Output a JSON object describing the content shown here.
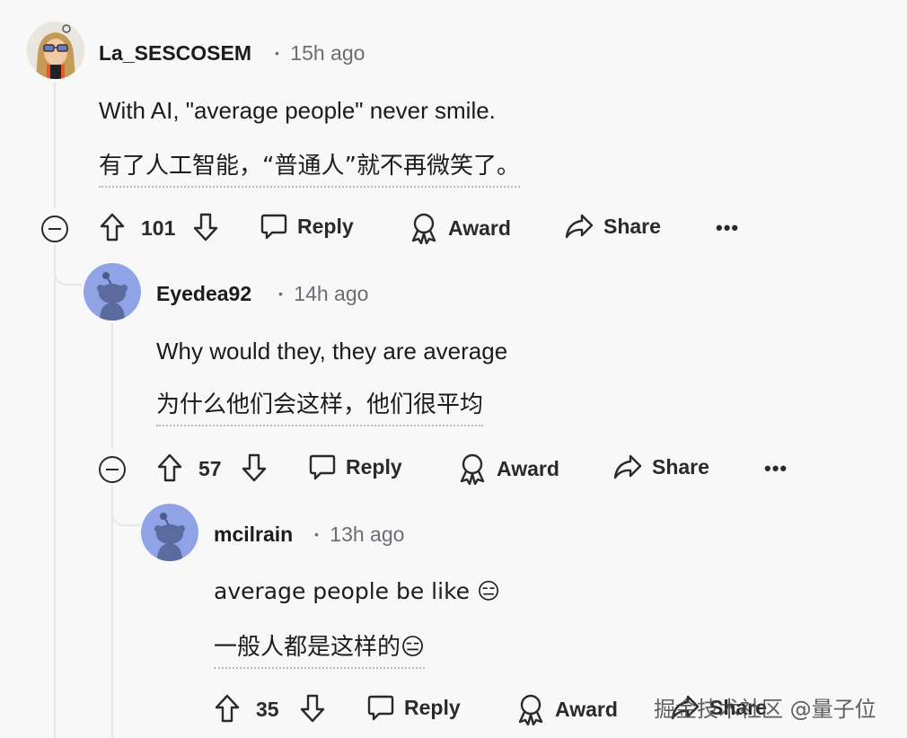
{
  "comments": [
    {
      "username": "La_SESCOSEM",
      "time": "15h ago",
      "text": "With AI, \"average people\" never smile.",
      "translation": "有了人工智能，“普通人”就不再微笑了。",
      "votes": "101",
      "actions": {
        "reply": "Reply",
        "award": "Award",
        "share": "Share",
        "more": "•••"
      }
    },
    {
      "username": "Eyedea92",
      "time": "14h ago",
      "text": "Why would they, they are average",
      "translation": "为什么他们会这样，他们很平均",
      "votes": "57",
      "actions": {
        "reply": "Reply",
        "award": "Award",
        "share": "Share",
        "more": "•••"
      }
    },
    {
      "username": "mcilrain",
      "time": "13h ago",
      "text": "average people be like 😑",
      "translation": "一般人都是这样的😑",
      "votes": "35",
      "actions": {
        "reply": "Reply",
        "award": "Award",
        "share": "Share"
      }
    }
  ],
  "meta_separator": "•",
  "watermark": "掘金技术社区 @量子位",
  "colors": {
    "background": "#f8f8f8",
    "snoo_avatar_bg": "#8fa3e6",
    "thread_line": "#e4e6e8"
  }
}
